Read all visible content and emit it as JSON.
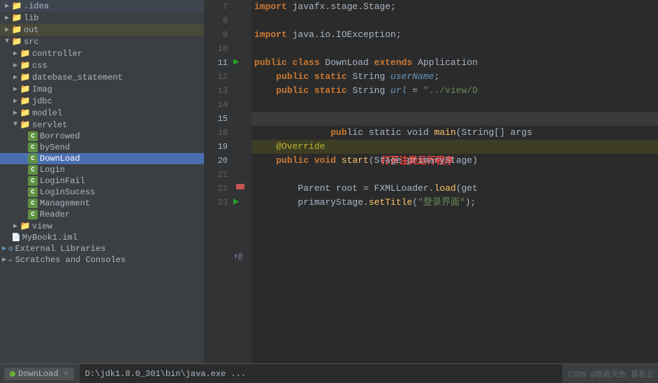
{
  "sidebar": {
    "items": [
      {
        "id": "idea",
        "label": ".idea",
        "type": "folder",
        "indent": 1,
        "expanded": false,
        "color": "plain"
      },
      {
        "id": "lib",
        "label": "lib",
        "type": "folder",
        "indent": 1,
        "expanded": false,
        "color": "plain"
      },
      {
        "id": "out",
        "label": "out",
        "type": "folder",
        "indent": 1,
        "expanded": false,
        "color": "yellow"
      },
      {
        "id": "src",
        "label": "src",
        "type": "folder",
        "indent": 1,
        "expanded": true,
        "color": "plain"
      },
      {
        "id": "controller",
        "label": "controller",
        "type": "folder",
        "indent": 2,
        "expanded": false,
        "color": "plain"
      },
      {
        "id": "css",
        "label": "css",
        "type": "folder",
        "indent": 2,
        "expanded": false,
        "color": "plain"
      },
      {
        "id": "datebase_statement",
        "label": "datebase_statement",
        "type": "folder",
        "indent": 2,
        "expanded": false,
        "color": "plain"
      },
      {
        "id": "Imag",
        "label": "Imag",
        "type": "folder",
        "indent": 2,
        "expanded": false,
        "color": "plain"
      },
      {
        "id": "jdbc",
        "label": "jdbc",
        "type": "folder",
        "indent": 2,
        "expanded": false,
        "color": "plain"
      },
      {
        "id": "modlel",
        "label": "modlel",
        "type": "folder",
        "indent": 2,
        "expanded": false,
        "color": "plain"
      },
      {
        "id": "servlet",
        "label": "servlet",
        "type": "folder",
        "indent": 2,
        "expanded": true,
        "color": "plain"
      },
      {
        "id": "Borrowed",
        "label": "Borrowed",
        "type": "class",
        "indent": 3,
        "selected": false
      },
      {
        "id": "bySend",
        "label": "bySend",
        "type": "class",
        "indent": 3,
        "selected": false
      },
      {
        "id": "DownLoad",
        "label": "DownLoad",
        "type": "class",
        "indent": 3,
        "selected": true
      },
      {
        "id": "Login",
        "label": "Login",
        "type": "class",
        "indent": 3,
        "selected": false
      },
      {
        "id": "LoginFail",
        "label": "LoginFail",
        "type": "class",
        "indent": 3,
        "selected": false
      },
      {
        "id": "LoginSucess",
        "label": "LoginSucess",
        "type": "class",
        "indent": 3,
        "selected": false
      },
      {
        "id": "Management",
        "label": "Management",
        "type": "class",
        "indent": 3,
        "selected": false
      },
      {
        "id": "Reader",
        "label": "Reader",
        "type": "class",
        "indent": 3,
        "selected": false
      },
      {
        "id": "view",
        "label": "view",
        "type": "folder",
        "indent": 2,
        "expanded": false,
        "color": "plain"
      },
      {
        "id": "MyBook1.iml",
        "label": "MyBook1.iml",
        "type": "file",
        "indent": 1
      },
      {
        "id": "ExternalLibraries",
        "label": "External Libraries",
        "type": "special",
        "indent": 0
      },
      {
        "id": "ScratchesConsoles",
        "label": "Scratches and Consoles",
        "type": "special",
        "indent": 0
      }
    ]
  },
  "editor": {
    "lines": [
      {
        "num": 7,
        "content": "import javafx.stage.Stage;"
      },
      {
        "num": 8,
        "content": ""
      },
      {
        "num": 9,
        "content": "import java.io.IOException;"
      },
      {
        "num": 10,
        "content": ""
      },
      {
        "num": 11,
        "content": "public class DownLoad extends Application"
      },
      {
        "num": 12,
        "content": "    public static String userName;"
      },
      {
        "num": 13,
        "content": "    public static String url = \"../view/D"
      },
      {
        "num": 14,
        "content": ""
      },
      {
        "num": 15,
        "content": "    public static void main(String[] args"
      },
      {
        "num": 18,
        "content": ""
      },
      {
        "num": 19,
        "content": "    @Override"
      },
      {
        "num": 20,
        "content": "    public void start(Stage primaryStage)"
      },
      {
        "num": 21,
        "content": ""
      },
      {
        "num": 22,
        "content": "        Parent root = FXMLLoader.load(get"
      },
      {
        "num": 23,
        "content": "        primaryStage.setTitle(\"登录界面\");"
      }
    ]
  },
  "bottom": {
    "run_label": "DownLoad",
    "path": "D:\\jdk1.8.0_301\\bin\\java.exe ...",
    "watermark": "CSDN @晚看天色 暮看云"
  },
  "annotation": {
    "text": "打开注类运行程序",
    "line": 15
  }
}
